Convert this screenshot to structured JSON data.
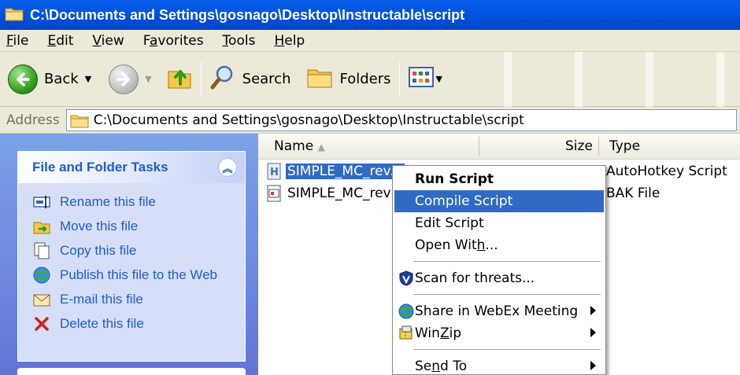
{
  "window": {
    "title": "C:\\Documents and Settings\\gosnago\\Desktop\\Instructable\\script"
  },
  "menubar": {
    "items": [
      {
        "key": "F",
        "rest": "ile"
      },
      {
        "key": "E",
        "rest": "dit"
      },
      {
        "key": "V",
        "rest": "iew"
      },
      {
        "pre": "F",
        "key": "a",
        "rest": "vorites"
      },
      {
        "key": "T",
        "rest": "ools"
      },
      {
        "key": "H",
        "rest": "elp"
      }
    ]
  },
  "toolbar": {
    "back_label": "Back",
    "search_label": "Search",
    "folders_label": "Folders"
  },
  "address": {
    "label": "Address",
    "path": "C:\\Documents and Settings\\gosnago\\Desktop\\Instructable\\script"
  },
  "tasks": {
    "title": "File and Folder Tasks",
    "items": [
      {
        "label": "Rename this file",
        "icon": "rename-icon"
      },
      {
        "label": "Move this file",
        "icon": "move-icon"
      },
      {
        "label": "Copy this file",
        "icon": "copy-icon"
      },
      {
        "label": "Publish this file to the Web",
        "icon": "publish-web-icon"
      },
      {
        "label": "E-mail this file",
        "icon": "email-icon"
      },
      {
        "label": "Delete this file",
        "icon": "delete-icon"
      }
    ]
  },
  "filelist": {
    "columns": {
      "name": "Name",
      "size": "Size",
      "type": "Type"
    },
    "rows": [
      {
        "name": "SIMPLE_MC_rev...",
        "type": "AutoHotkey Script",
        "selected": true
      },
      {
        "name": "SIMPLE_MC_rev",
        "type": "BAK File",
        "selected": false
      }
    ]
  },
  "context_menu": {
    "items": [
      {
        "label": "Run Script",
        "bold": true
      },
      {
        "label": "Compile Script",
        "highlighted": true
      },
      {
        "label": "Edit Script"
      },
      {
        "pre": "Open Wit",
        "key": "h",
        "rest": "..."
      },
      {
        "label": "Scan for threats..."
      },
      {
        "label": "Share in WebEx Meeting"
      },
      {
        "pre": "Win",
        "key": "Z",
        "rest": "ip"
      },
      {
        "pre": "Se",
        "key": "n",
        "rest": "d To"
      }
    ]
  },
  "colors": {
    "titlebar": "#0054e3",
    "selection": "#316ac5",
    "task_link": "#215dc6",
    "chrome": "#ece9d8"
  }
}
